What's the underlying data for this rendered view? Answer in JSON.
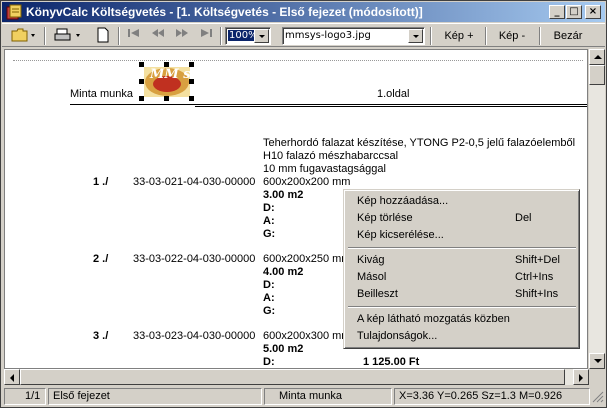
{
  "window": {
    "title": "KönyvCalc Költségvetés - [1. Költségvetés - Első fejezet (módosított)]",
    "controls": {
      "minimize": "_",
      "restore": "□",
      "close": "×"
    }
  },
  "toolbar": {
    "kep_plus": "Kép +",
    "kep_minus": "Kép -",
    "close_label": "Bezár",
    "zoom_value": "100%",
    "image_file": "mmsys-logo3.jpg"
  },
  "document": {
    "header_left": "Minta munka",
    "header_center": "1.oldal",
    "item1": {
      "desc_line1": "Teherhordó falazat készítése, YTONG P2-0,5 jelű falazóelemből",
      "desc_line2": "H10 falazó mészhabarccsal",
      "desc_line3": "10 mm fugavastagsággal",
      "size": "600x200x200 mm",
      "number": "1 ./",
      "code": "33-03-021-04-030-00000",
      "qty": "3.00 m2",
      "d": "D:",
      "a": "A:",
      "g": "G:"
    },
    "item2": {
      "number": "2 ./",
      "code": "33-03-022-04-030-00000",
      "size": "600x200x250 mm",
      "qty": "4.00 m2",
      "d": "D:",
      "a": "A:",
      "g": "G:"
    },
    "item3": {
      "number": "3 ./",
      "code": "33-03-023-04-030-00000",
      "size": "600x200x300 mm",
      "qty": "5.00 m2",
      "d": "D:",
      "price": "1 125.00 Ft"
    },
    "logo_text": "MM sys"
  },
  "context_menu": {
    "items": [
      {
        "label": "Kép hozzáadása...",
        "shortcut": ""
      },
      {
        "label": "Kép törlése",
        "shortcut": "Del"
      },
      {
        "label": "Kép kicserélése...",
        "shortcut": ""
      },
      {
        "label": "Kivág",
        "shortcut": "Shift+Del"
      },
      {
        "label": "Másol",
        "shortcut": "Ctrl+Ins"
      },
      {
        "label": "Beilleszt",
        "shortcut": "Shift+Ins"
      },
      {
        "label": "A kép látható mozgatás közben",
        "shortcut": ""
      },
      {
        "label": "Tulajdonságok...",
        "shortcut": ""
      }
    ]
  },
  "statusbar": {
    "page": "1/1",
    "chapter": "Első fejezet",
    "project": "Minta munka",
    "coords": "X=3.36  Y=0.265  Sz=1.3  M=0.926"
  }
}
